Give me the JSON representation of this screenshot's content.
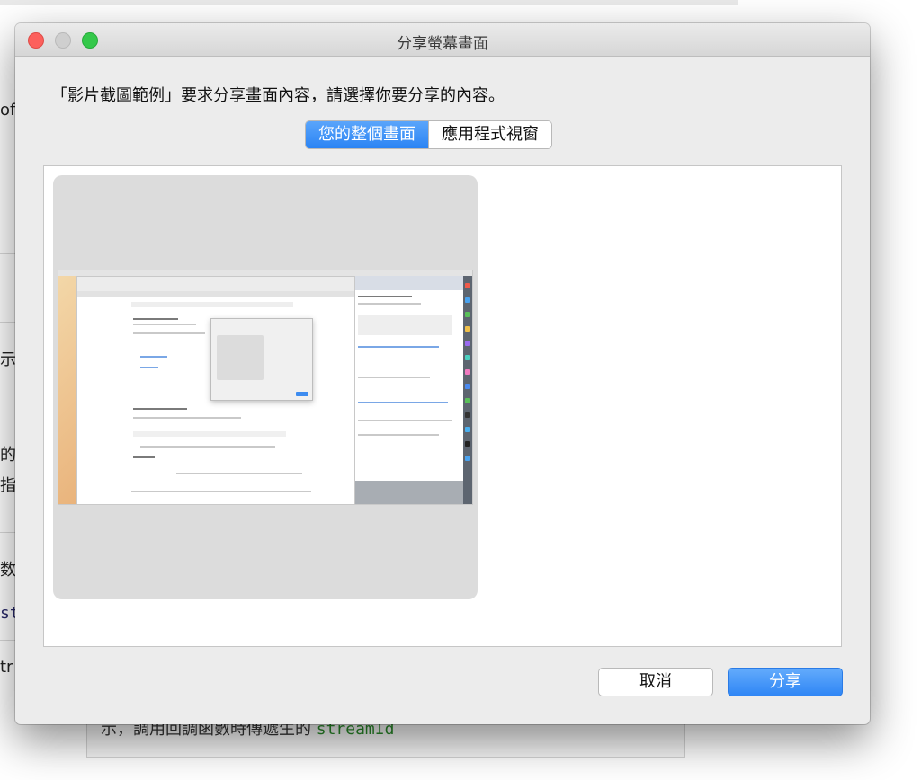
{
  "background": {
    "fragments": [
      "of",
      "示的",
      "的可",
      "指定",
      "数",
      "st",
      "tr"
    ],
    "code_text": "示，調用回調函數時傳遞生的",
    "code_ident": "streamId"
  },
  "dialog": {
    "title": "分享螢幕畫面",
    "prompt": "「影片截圖範例」要求分享畫面內容，請選擇你要分享的內容。",
    "tabs": [
      {
        "label": "您的整個畫面",
        "selected": true
      },
      {
        "label": "應用程式視窗",
        "selected": false
      }
    ],
    "cancel_label": "取消",
    "share_label": "分享",
    "accent_color": "#2f86f5"
  }
}
